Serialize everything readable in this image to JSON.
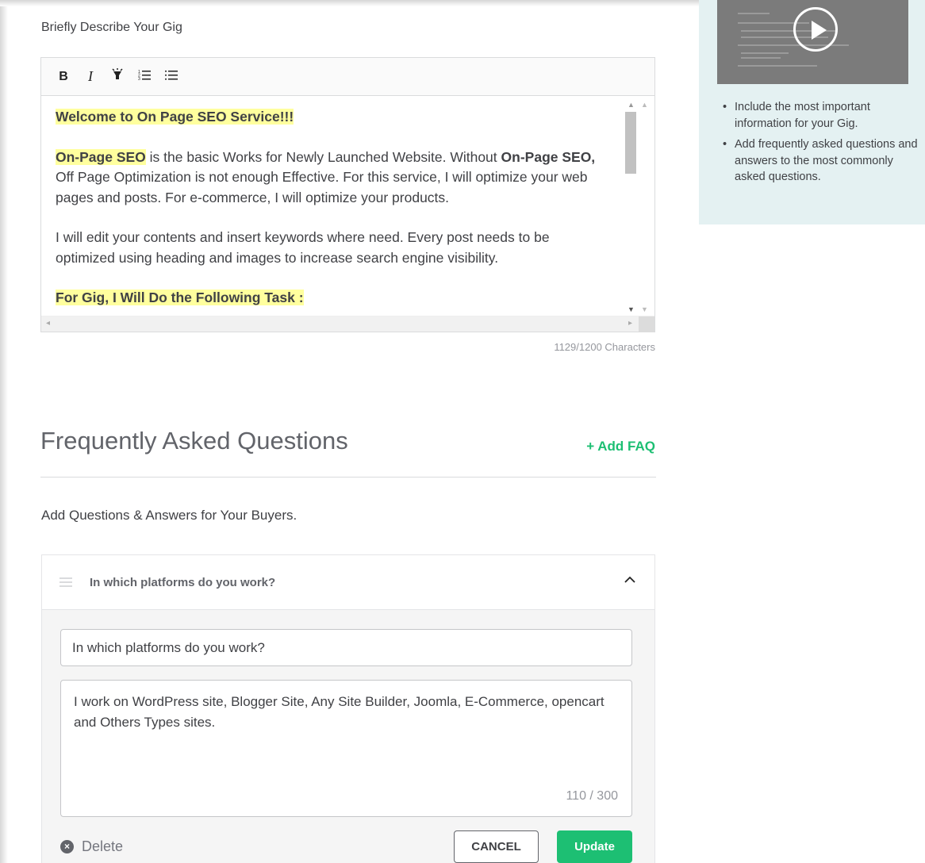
{
  "description": {
    "label": "Briefly Describe Your Gig",
    "toolbar": {
      "bold": "B",
      "italic": "I",
      "highlight": "♦",
      "ordered_list": "≡",
      "unordered_list": "≡"
    },
    "content": {
      "p1_heading": "Welcome to On Page SEO Service!!!",
      "p2_strong_a": "On-Page SEO",
      "p2_text_a": " is the basic Works for Newly Launched Website. Without ",
      "p2_strong_b": "On-Page SEO,",
      "p2_text_b": " Off Page Optimization is not enough Effective. For this service, I will optimize your web pages and posts. For e-commerce, I will optimize your products.",
      "p3": "I will edit your contents and insert keywords where need. Every post needs to be optimized using heading and images to increase search engine visibility.",
      "p4_heading": "For Gig, I Will Do the Following Task :"
    },
    "char_count": "1129/1200 Characters"
  },
  "faq": {
    "title": "Frequently Asked Questions",
    "add_label": "+ Add FAQ",
    "subtitle": "Add Questions & Answers for Your Buyers.",
    "items": [
      {
        "question": "In which platforms do you work?",
        "question_value": "In which platforms do you work?",
        "answer_value": "I work on WordPress site, Blogger Site, Any Site Builder, Joomla, E-Commerce, opencart and Others Types sites.",
        "answer_count": "110 / 300"
      }
    ],
    "delete_label": "Delete",
    "cancel_label": "CANCEL",
    "update_label": "Update"
  },
  "tips": {
    "items": [
      "Include the most important information for your Gig.",
      "Add frequently asked questions and answers to the most commonly asked questions."
    ]
  },
  "colors": {
    "accent": "#1dbf73",
    "tips_bg": "#e4f1f2",
    "highlight": "#ffff9e"
  },
  "icons": [
    "bold-icon",
    "italic-icon",
    "highlight-icon",
    "ordered-list-icon",
    "unordered-list-icon",
    "play-icon",
    "drag-handle-icon",
    "chevron-up-icon",
    "delete-icon"
  ]
}
